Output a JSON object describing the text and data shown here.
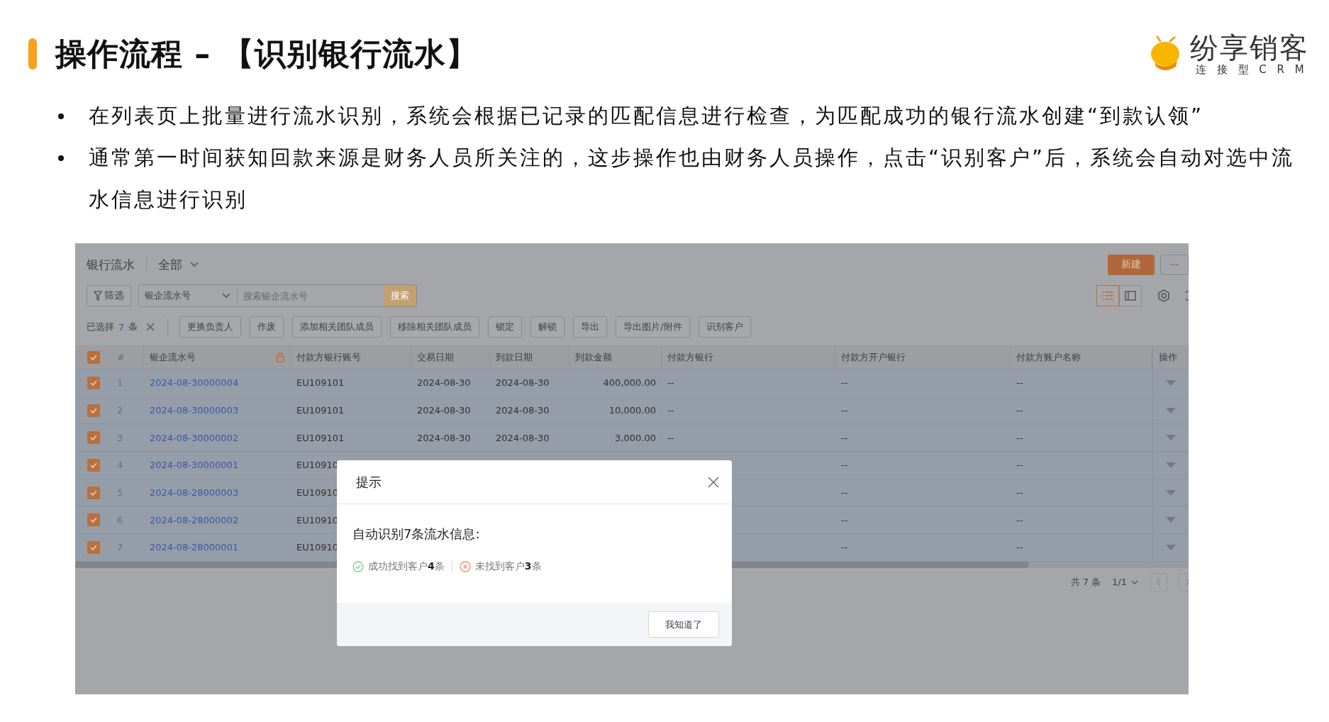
{
  "slide": {
    "title": "操作流程 – 【识别银行流水】",
    "logo": {
      "name": "纷享销客",
      "tagline": "连 接 型 C R M"
    },
    "bullets": [
      "在列表页上批量进行流水识别，系统会根据已记录的匹配信息进行检查，为匹配成功的银行流水创建“到款认领”",
      "通常第一时间获知回款来源是财务人员所关注的，这步操作也由财务人员操作，点击“识别客户”后，系统会自动对选中流水信息进行识别"
    ]
  },
  "app": {
    "module": "银行流水",
    "view": "全部",
    "new_button": "新建",
    "more_button": "···",
    "filter_button": "筛选",
    "search": {
      "field_select": "银企流水号",
      "placeholder": "搜索银企流水号",
      "button": "搜索"
    },
    "view_toggles": [
      {
        "kind": "list",
        "selected": true
      },
      {
        "kind": "panel",
        "selected": false
      }
    ],
    "selection": {
      "label": "已选择",
      "count": "7",
      "unit": "条"
    },
    "actions": [
      "更换负责人",
      "作废",
      "添加相关团队成员",
      "移除相关团队成员",
      "锁定",
      "解锁",
      "导出",
      "导出图片/附件",
      "识别客户"
    ],
    "table": {
      "all_checked": true,
      "columns": [
        "#",
        "银企流水号",
        "付款方银行账号",
        "交易日期",
        "到款日期",
        "到款金额",
        "付款方银行",
        "付款方开户银行",
        "付款方账户名称",
        "操作"
      ],
      "rows": [
        {
          "checked": true,
          "index": "1",
          "serial": "2024-08-30000004",
          "payer_account": "EU109101",
          "trade_date": "2024-08-30",
          "arrival_date": "2024-08-30",
          "amount": "400,000.00",
          "payer_bank": "--",
          "opening_bank": "--",
          "account_name": "--"
        },
        {
          "checked": true,
          "index": "2",
          "serial": "2024-08-30000003",
          "payer_account": "EU109101",
          "trade_date": "2024-08-30",
          "arrival_date": "2024-08-30",
          "amount": "10,000.00",
          "payer_bank": "--",
          "opening_bank": "--",
          "account_name": "--"
        },
        {
          "checked": true,
          "index": "3",
          "serial": "2024-08-30000002",
          "payer_account": "EU109101",
          "trade_date": "2024-08-30",
          "arrival_date": "2024-08-30",
          "amount": "3,000.00",
          "payer_bank": "--",
          "opening_bank": "--",
          "account_name": "--"
        },
        {
          "checked": true,
          "index": "4",
          "serial": "2024-08-30000001",
          "payer_account": "EU10910",
          "opening_bank": "--",
          "account_name": "--"
        },
        {
          "checked": true,
          "index": "5",
          "serial": "2024-08-28000003",
          "payer_account": "EU10910",
          "opening_bank": "--",
          "account_name": "--"
        },
        {
          "checked": true,
          "index": "6",
          "serial": "2024-08-28000002",
          "payer_account": "EU10910",
          "opening_bank": "--",
          "account_name": "--"
        },
        {
          "checked": true,
          "index": "7",
          "serial": "2024-08-28000001",
          "payer_account": "EU10910",
          "opening_bank": "--",
          "account_name": "--"
        }
      ]
    },
    "pagination": {
      "total": "共 7 条",
      "page": "1/1"
    }
  },
  "dialog": {
    "title": "提示",
    "message": "自动识别7条流水信息:",
    "results": [
      {
        "kind": "success",
        "text": "成功找到客户**4**条"
      },
      {
        "kind": "failure",
        "text": "未找到客户**3**条"
      }
    ],
    "button": "我知道了"
  }
}
